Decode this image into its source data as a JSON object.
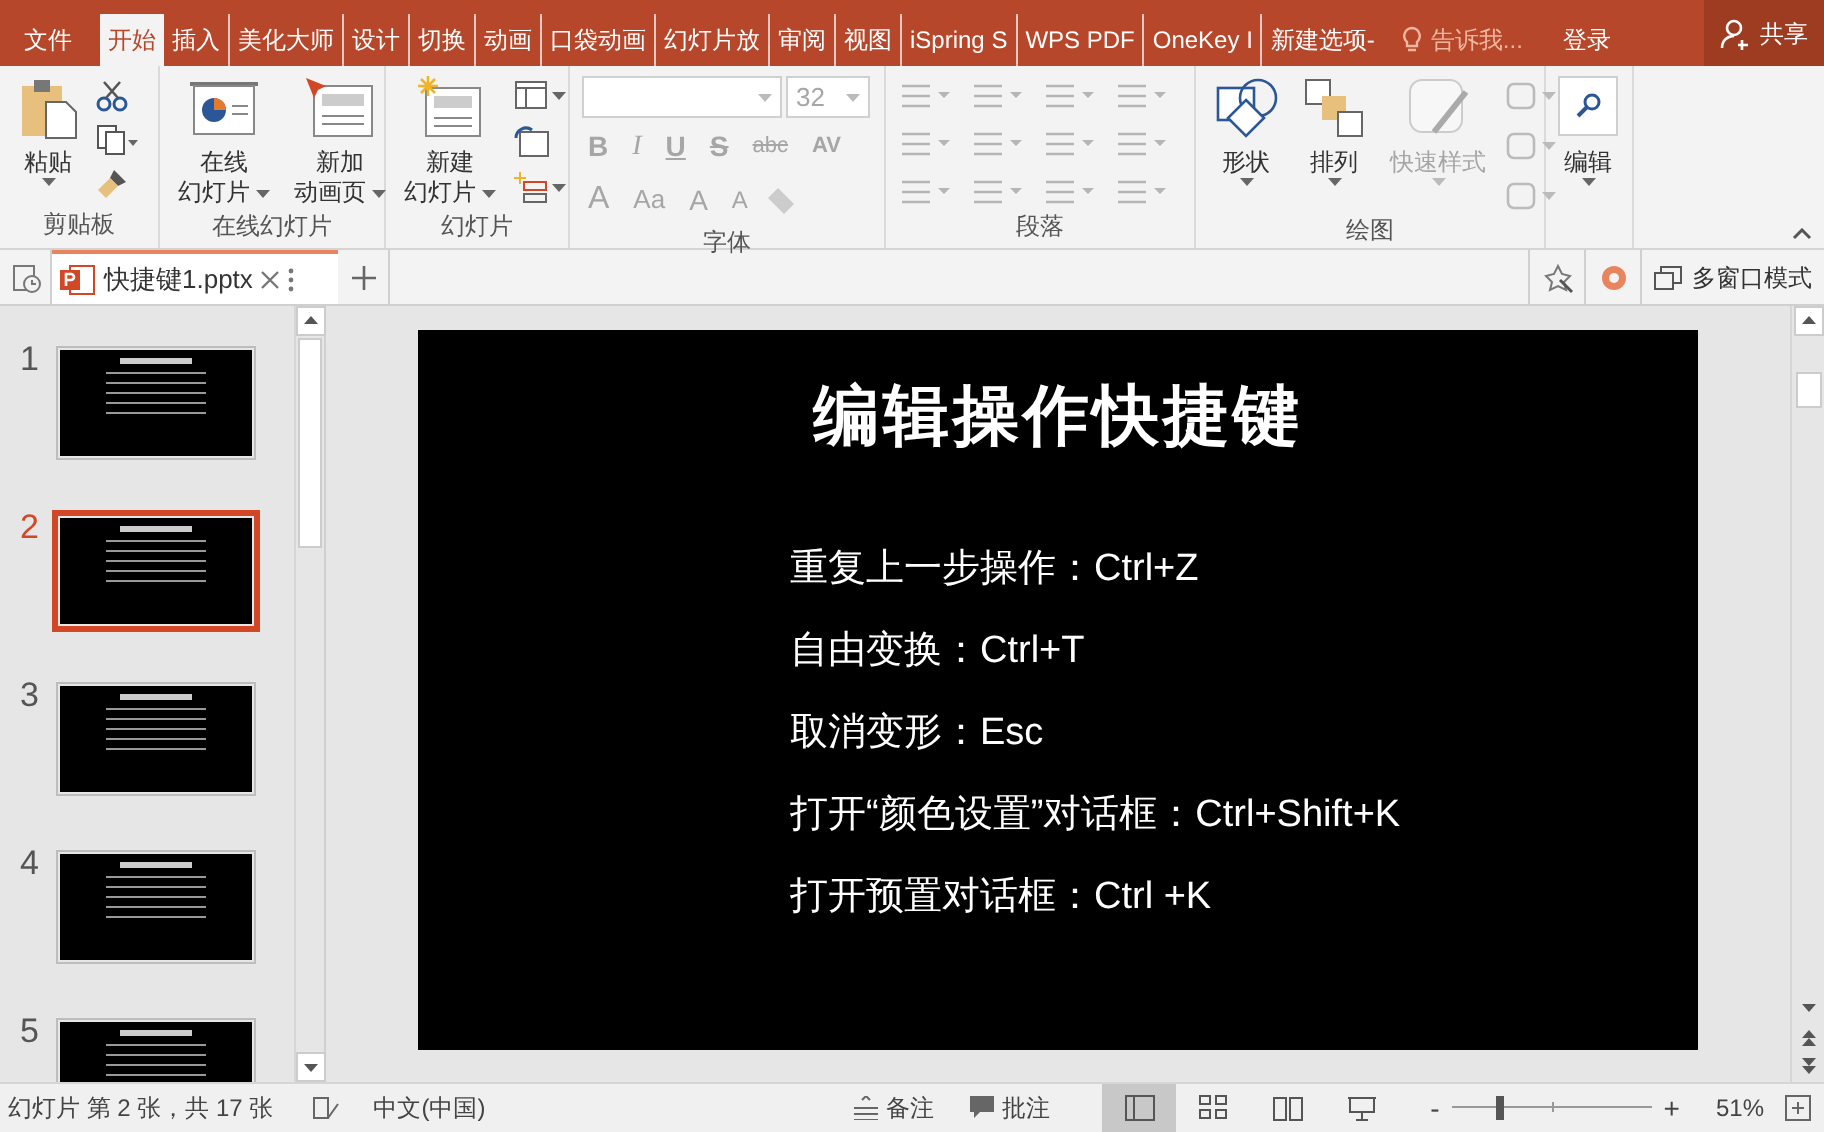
{
  "ribbon_tabs": [
    {
      "label": "文件",
      "selected": false
    },
    {
      "label": "开始",
      "selected": true
    },
    {
      "label": "插入",
      "selected": false
    },
    {
      "label": "美化大师",
      "selected": false
    },
    {
      "label": "设计",
      "selected": false
    },
    {
      "label": "切换",
      "selected": false
    },
    {
      "label": "动画",
      "selected": false
    },
    {
      "label": "口袋动画",
      "selected": false
    },
    {
      "label": "幻灯片放",
      "selected": false
    },
    {
      "label": "审阅",
      "selected": false
    },
    {
      "label": "视图",
      "selected": false
    },
    {
      "label": "iSpring S",
      "selected": false
    },
    {
      "label": "WPS PDF",
      "selected": false
    },
    {
      "label": "OneKey I",
      "selected": false
    },
    {
      "label": "新建选项-",
      "selected": false
    }
  ],
  "tell_me": {
    "placeholder": "告诉我..."
  },
  "sign_in": "登录",
  "share": "共享",
  "clipboard": {
    "label": "剪贴板",
    "paste": "粘贴"
  },
  "online_slides": {
    "label": "在线幻灯片",
    "buttons": [
      [
        "在线",
        "幻灯片"
      ],
      [
        "新加",
        "动画页"
      ]
    ]
  },
  "slides_group": {
    "label": "幻灯片",
    "new_slide": [
      "新建",
      "幻灯片"
    ]
  },
  "font": {
    "label": "字体",
    "disabled": true,
    "font_size": "32",
    "format_buttons": [
      "B",
      "I",
      "U",
      "S",
      "abc",
      "AV"
    ],
    "size_buttons": [
      "A",
      "Aa",
      "A",
      "A"
    ]
  },
  "paragraph": {
    "label": "段落",
    "disabled": true
  },
  "drawing": {
    "label": "绘图",
    "buttons": [
      {
        "label": "形状",
        "disabled": false
      },
      {
        "label": "排列",
        "disabled": false
      },
      {
        "label": "快速样式",
        "disabled": true
      }
    ]
  },
  "editing": {
    "label": "编辑"
  },
  "document_tab": {
    "title": "快捷键1.pptx"
  },
  "window_mode": "多窗口模式",
  "slides": [
    {
      "number": "1",
      "selected": false
    },
    {
      "number": "2",
      "selected": true
    },
    {
      "number": "3",
      "selected": false
    },
    {
      "number": "4",
      "selected": false
    },
    {
      "number": "5",
      "selected": false
    }
  ],
  "slide": {
    "title": "编辑操作快捷键",
    "lines": [
      "重复上一步操作：Ctrl+Z",
      "自由变换：Ctrl+T",
      "取消变形：Esc",
      "打开“颜色设置”对话框：Ctrl+Shift+K",
      "打开预置对话框：Ctrl +K"
    ]
  },
  "status_bar": {
    "slide_info": "幻灯片 第 2 张，共 17 张",
    "language": "中文(中国)",
    "notes": "备注",
    "comments": "批注",
    "views": [
      {
        "kind": "normal",
        "selected": true
      },
      {
        "kind": "sorter",
        "selected": false
      },
      {
        "kind": "reading",
        "selected": false
      },
      {
        "kind": "slideshow",
        "selected": false
      }
    ],
    "zoom_out": "-",
    "zoom_in": "+",
    "zoom": {
      "level": 0.24
    },
    "zoom_percent": "51%"
  }
}
